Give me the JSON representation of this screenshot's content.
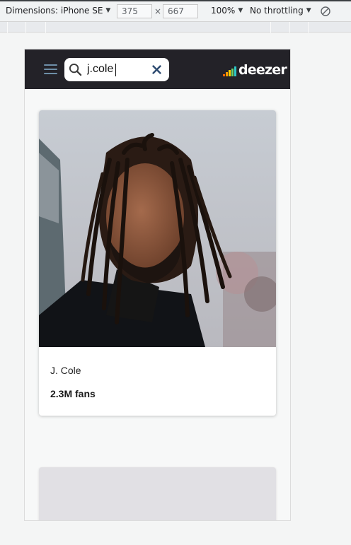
{
  "devtools": {
    "dimensions_label": "Dimensions: iPhone SE",
    "width": "375",
    "times": "×",
    "height": "667",
    "zoom": "100%",
    "throttling": "No throttling",
    "icons": {
      "caret": "▼",
      "rotate": "rotate-icon"
    }
  },
  "app": {
    "brand": "deezer",
    "header_bg": "#232228",
    "search": {
      "value": "j.cole",
      "placeholder": ""
    },
    "icons": {
      "menu": "hamburger-icon",
      "search": "search-icon",
      "clear": "close-icon",
      "logo": "deezer-logo"
    }
  },
  "results": [
    {
      "name": "J. Cole",
      "fans": "2.3M fans",
      "image": "artist-photo"
    }
  ],
  "colors": {
    "accent": "#2d4b70",
    "page_bg": "#f7f8f8",
    "placeholder_card": "#e1e0e4"
  }
}
